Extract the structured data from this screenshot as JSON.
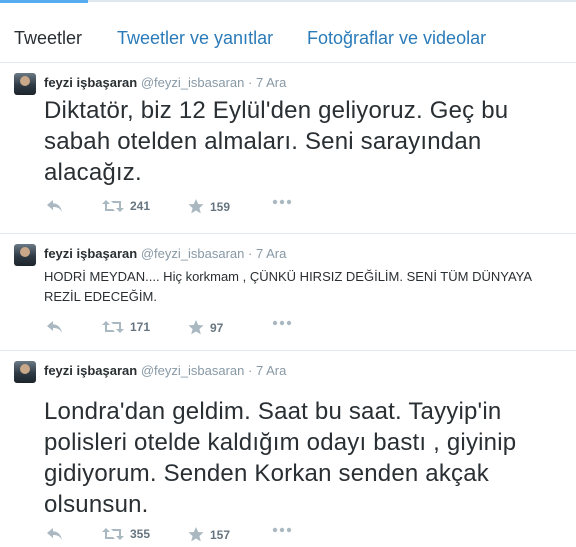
{
  "tabs": [
    {
      "label": "Tweetler"
    },
    {
      "label": "Tweetler ve yanıtlar"
    },
    {
      "label": "Fotoğraflar ve videolar"
    }
  ],
  "tweets": [
    {
      "name": "feyzi işbaşaran",
      "handle": "@feyzi_isbasaran",
      "separator": "·",
      "time": "7 Ara",
      "text": "Diktatör, biz 12 Eylül'den geliyoruz. Geç bu sabah otelden almaları. Seni sarayından alacağız.",
      "retweets": "241",
      "favorites": "159"
    },
    {
      "name": "feyzi işbaşaran",
      "handle": "@feyzi_isbasaran",
      "separator": "·",
      "time": "7 Ara",
      "text": "HODRİ MEYDAN.... Hiç korkmam , ÇÜNKÜ HIRSIZ DEĞİLİM. SENİ TÜM DÜNYAYA REZİL EDECEĞİM.",
      "retweets": "171",
      "favorites": "97"
    },
    {
      "name": "feyzi işbaşaran",
      "handle": "@feyzi_isbasaran",
      "separator": "·",
      "time": "7 Ara",
      "text": "Londra'dan geldim. Saat bu saat. Tayyip'in polisleri otelde kaldığım odayı bastı , giyinip gidiyorum. Senden Korkan senden akçak olsunsun.",
      "retweets": "355",
      "favorites": "157"
    }
  ]
}
